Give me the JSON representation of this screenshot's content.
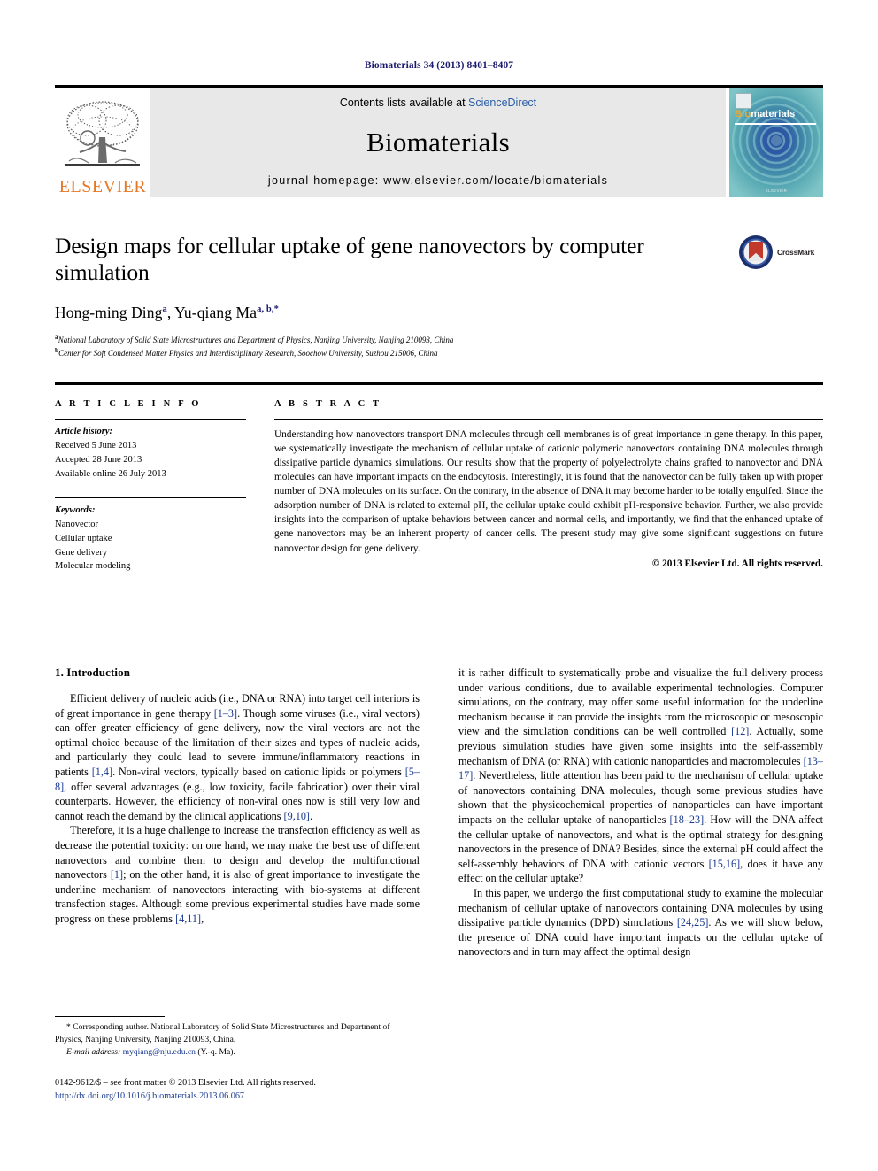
{
  "running_head": "Biomaterials 34 (2013) 8401–8407",
  "masthead": {
    "contents_prefix": "Contents lists available at ",
    "sciencedirect": "ScienceDirect",
    "journal_name": "Biomaterials",
    "homepage": "journal homepage: www.elsevier.com/locate/biomaterials",
    "publisher_wordmark": "ELSEVIER",
    "cover": {
      "title_bio": "Bio",
      "title_materials": "materials",
      "footer": "ELSEVIER"
    },
    "colors": {
      "band_background": "#e8e8e8",
      "sciencedirect_link": "#2b5fa8",
      "elsevier_orange": "#E87722",
      "cover_teal": "#1f6f86"
    }
  },
  "crossmark": {
    "label": "CrossMark",
    "ring_color": "#1a2f6b",
    "book_color": "#c0392b"
  },
  "article": {
    "title": "Design maps for cellular uptake of gene nanovectors by computer simulation",
    "authors_html": "Hong-ming Ding<sup>a</sup>, Yu-qiang Ma<sup>a, b,</sup><sup>*</sup>",
    "affiliations": [
      {
        "marker": "a",
        "text": "National Laboratory of Solid State Microstructures and Department of Physics, Nanjing University, Nanjing 210093, China"
      },
      {
        "marker": "b",
        "text": "Center for Soft Condensed Matter Physics and Interdisciplinary Research, Soochow University, Suzhou 215006, China"
      }
    ]
  },
  "article_info": {
    "heading": "A R T I C L E   I N F O",
    "history_label": "Article history:",
    "history": [
      "Received 5 June 2013",
      "Accepted 28 June 2013",
      "Available online 26 July 2013"
    ],
    "keywords_label": "Keywords:",
    "keywords": [
      "Nanovector",
      "Cellular uptake",
      "Gene delivery",
      "Molecular modeling"
    ]
  },
  "abstract": {
    "heading": "A B S T R A C T",
    "text": "Understanding how nanovectors transport DNA molecules through cell membranes is of great importance in gene therapy. In this paper, we systematically investigate the mechanism of cellular uptake of cationic polymeric nanovectors containing DNA molecules through dissipative particle dynamics simulations. Our results show that the property of polyelectrolyte chains grafted to nanovector and DNA molecules can have important impacts on the endocytosis. Interestingly, it is found that the nanovector can be fully taken up with proper number of DNA molecules on its surface. On the contrary, in the absence of DNA it may become harder to be totally engulfed. Since the adsorption number of DNA is related to external pH, the cellular uptake could exhibit pH-responsive behavior. Further, we also provide insights into the comparison of uptake behaviors between cancer and normal cells, and importantly, we find that the enhanced uptake of gene nanovectors may be an inherent property of cancer cells. The present study may give some significant suggestions on future nanovector design for gene delivery.",
    "copyright": "© 2013 Elsevier Ltd. All rights reserved."
  },
  "introduction": {
    "heading": "1.  Introduction",
    "paragraphs_left": [
      "Efficient delivery of nucleic acids (i.e., DNA or RNA) into target cell interiors is of great importance in gene therapy <span class=\"ref\">[1–3]</span>. Though some viruses (i.e., viral vectors) can offer greater efficiency of gene delivery, now the viral vectors are not the optimal choice because of the limitation of their sizes and types of nucleic acids, and particularly they could lead to severe immune/inflammatory reactions in patients <span class=\"ref\">[1,4]</span>. Non-viral vectors, typically based on cationic lipids or polymers <span class=\"ref\">[5–8]</span>, offer several advantages (e.g., low toxicity, facile fabrication) over their viral counterparts. However, the efficiency of non-viral ones now is still very low and cannot reach the demand by the clinical applications <span class=\"ref\">[9,10]</span>.",
      "Therefore, it is a huge challenge to increase the transfection efficiency as well as decrease the potential toxicity: on one hand, we may make the best use of different nanovectors and combine them to design and develop the multifunctional nanovectors <span class=\"ref\">[1]</span>; on the other hand, it is also of great importance to investigate the underline mechanism of nanovectors interacting with bio-systems at different transfection stages. Although some previous experimental studies have made some progress on these problems <span class=\"ref\">[4,11]</span>,"
    ],
    "paragraphs_right": [
      "it is rather difficult to systematically probe and visualize the full delivery process under various conditions, due to available experimental technologies. Computer simulations, on the contrary, may offer some useful information for the underline mechanism because it can provide the insights from the microscopic or mesoscopic view and the simulation conditions can be well controlled <span class=\"ref\">[12]</span>. Actually, some previous simulation studies have given some insights into the self-assembly mechanism of DNA (or RNA) with cationic nanoparticles and macromolecules <span class=\"ref\">[13–17]</span>. Nevertheless, little attention has been paid to the mechanism of cellular uptake of nanovectors containing DNA molecules, though some previous studies have shown that the physicochemical properties of nanoparticles can have important impacts on the cellular uptake of nanoparticles <span class=\"ref\">[18–23]</span>. How will the DNA affect the cellular uptake of nanovectors, and what is the optimal strategy for designing nanovectors in the presence of DNA? Besides, since the external pH could affect the self-assembly behaviors of DNA with cationic vectors <span class=\"ref\">[15,16]</span>, does it have any effect on the cellular uptake?",
      "In this paper, we undergo the first computational study to examine the molecular mechanism of cellular uptake of nanovectors containing DNA molecules by using dissipative particle dynamics (DPD) simulations <span class=\"ref\">[24,25]</span>. As we will show below, the presence of DNA could have important impacts on the cellular uptake of nanovectors and in turn may affect the optimal design"
    ]
  },
  "footnote": {
    "corresponding": "* Corresponding author. National Laboratory of Solid State Microstructures and Department of Physics, Nanjing University, Nanjing 210093, China.",
    "email_label": "E-mail address:",
    "email": "myqiang@nju.edu.cn",
    "email_suffix": "(Y.-q. Ma)."
  },
  "page_footer": {
    "front_matter": "0142-9612/$ – see front matter © 2013 Elsevier Ltd. All rights reserved.",
    "doi": "http://dx.doi.org/10.1016/j.biomaterials.2013.06.067"
  }
}
